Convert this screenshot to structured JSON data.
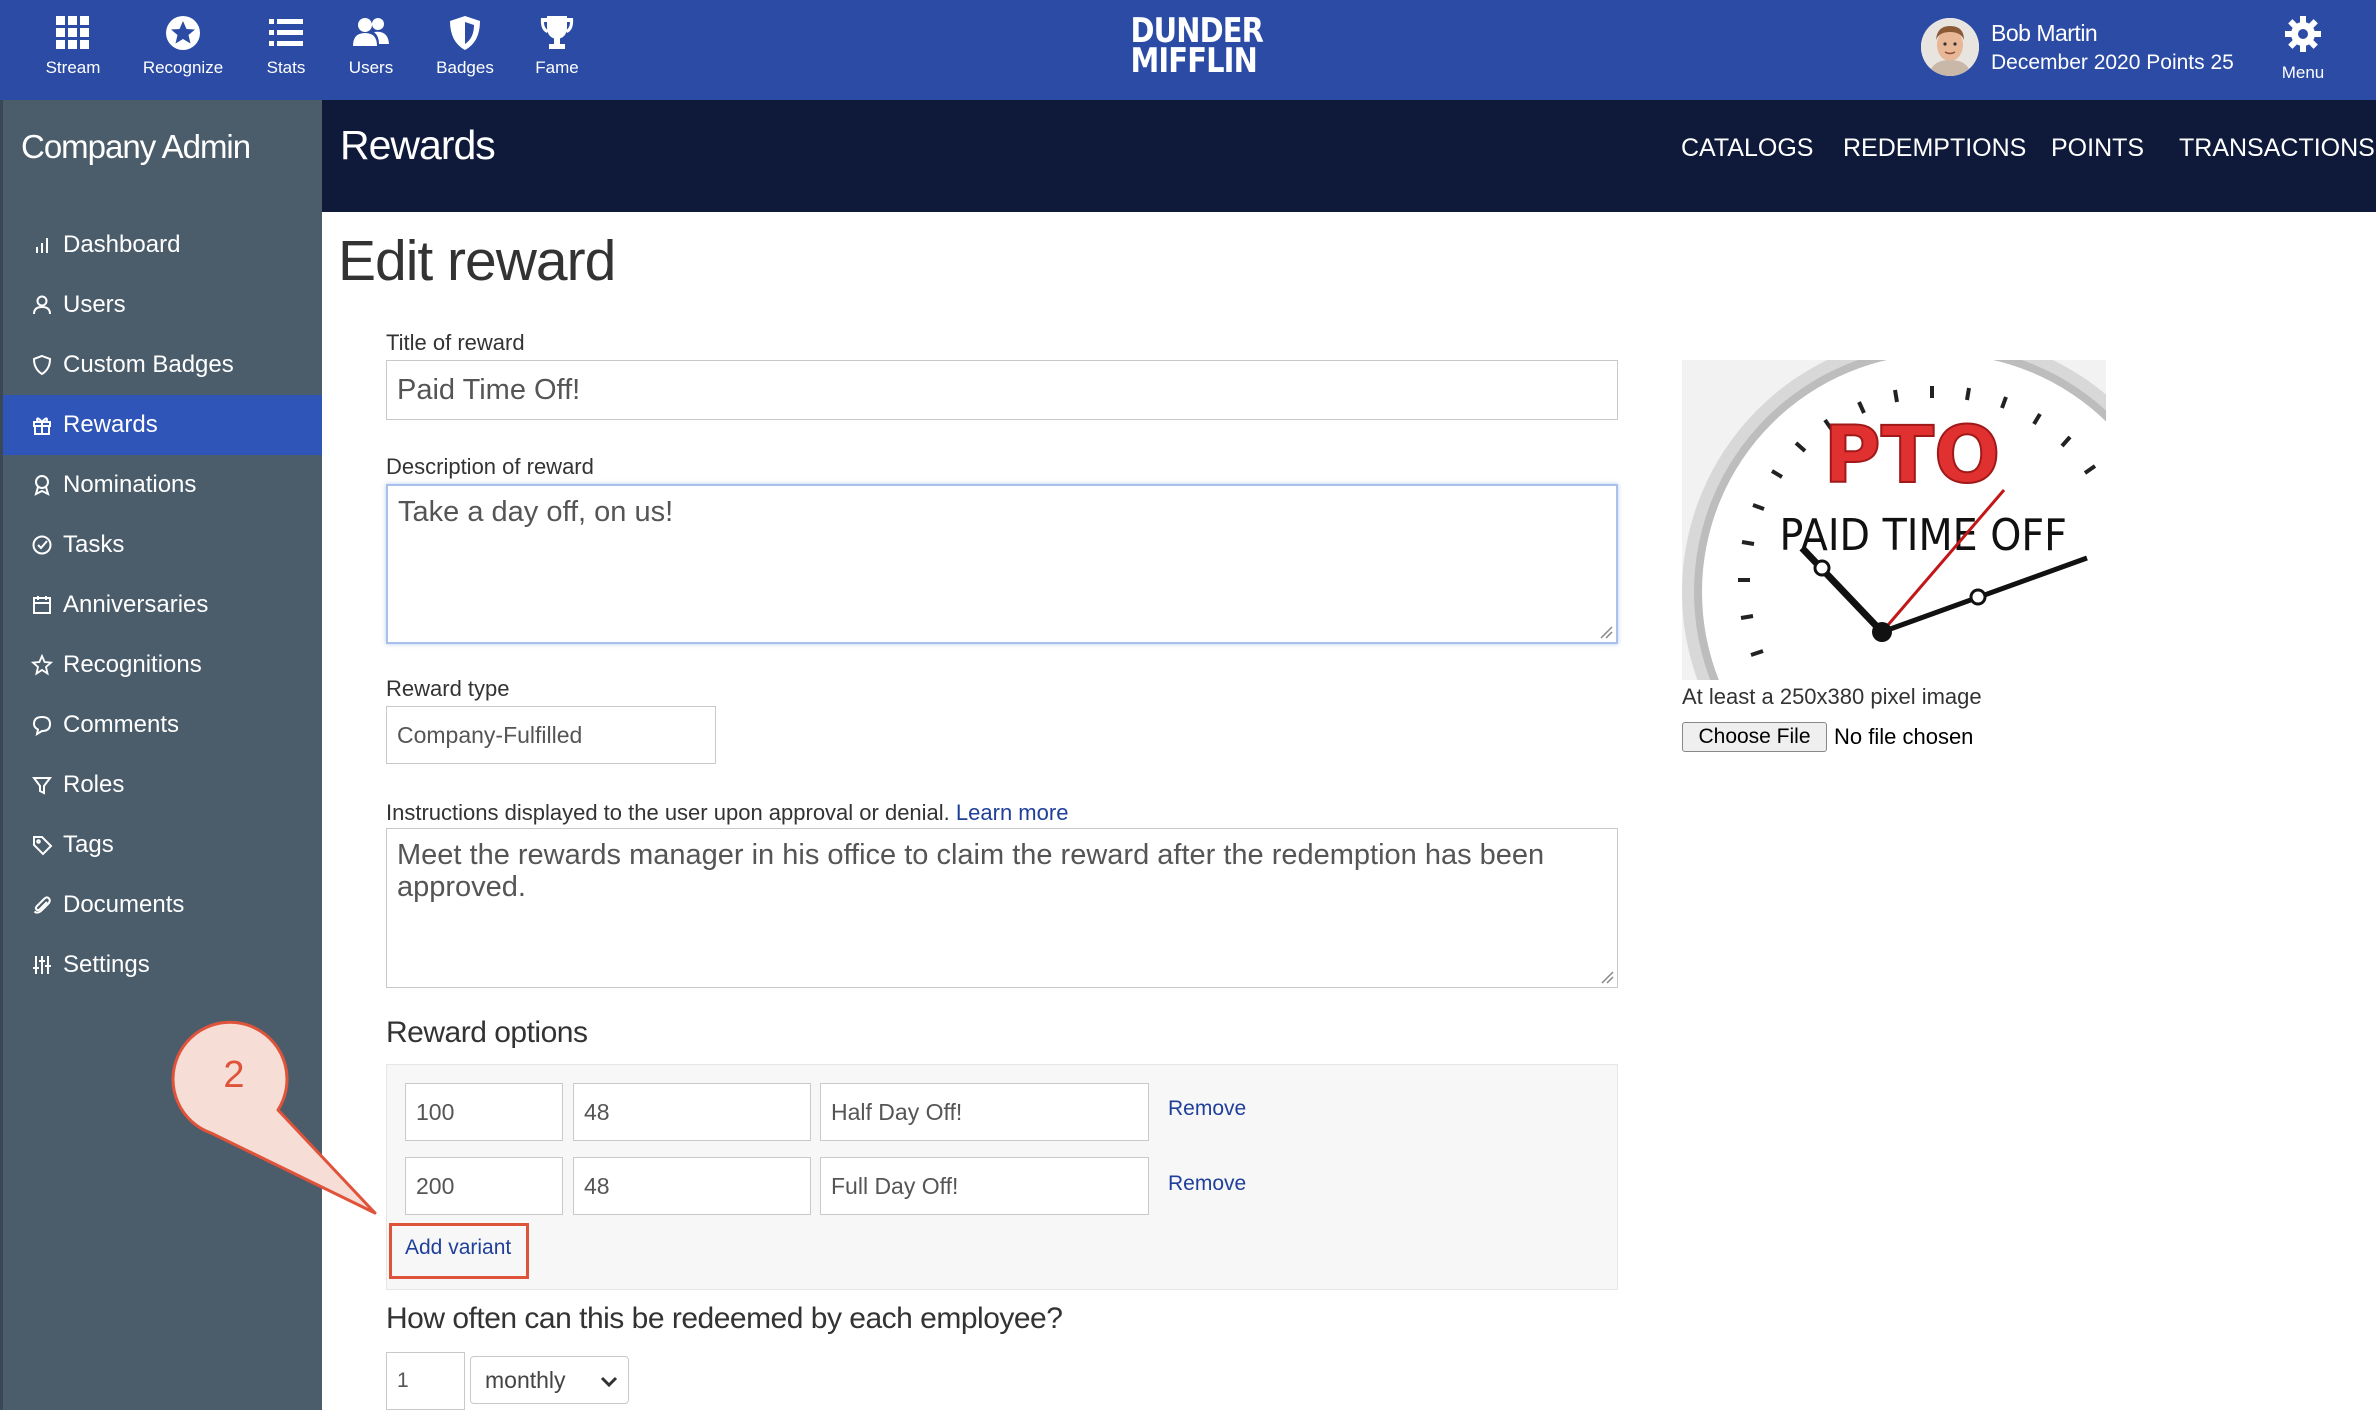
{
  "topnav": {
    "items": [
      {
        "label": "Stream",
        "icon": "grid-icon"
      },
      {
        "label": "Recognize",
        "icon": "star-badge-icon"
      },
      {
        "label": "Stats",
        "icon": "list-icon"
      },
      {
        "label": "Users",
        "icon": "users-icon"
      },
      {
        "label": "Badges",
        "icon": "shield-icon"
      },
      {
        "label": "Fame",
        "icon": "trophy-icon"
      }
    ],
    "logo_line1": "DUNDER",
    "logo_line2": "MIFFLIN",
    "user_name": "Bob Martin",
    "user_points": "December 2020 Points 25",
    "menu_label": "Menu"
  },
  "sidebar": {
    "title": "Company Admin",
    "items": [
      {
        "label": "Dashboard",
        "icon": "bar-chart-icon"
      },
      {
        "label": "Users",
        "icon": "user-icon"
      },
      {
        "label": "Custom Badges",
        "icon": "shield-icon"
      },
      {
        "label": "Rewards",
        "icon": "gift-icon",
        "active": true
      },
      {
        "label": "Nominations",
        "icon": "ribbon-icon"
      },
      {
        "label": "Tasks",
        "icon": "check-circle-icon"
      },
      {
        "label": "Anniversaries",
        "icon": "calendar-icon"
      },
      {
        "label": "Recognitions",
        "icon": "star-icon"
      },
      {
        "label": "Comments",
        "icon": "comment-icon"
      },
      {
        "label": "Roles",
        "icon": "filter-icon"
      },
      {
        "label": "Tags",
        "icon": "tag-icon"
      },
      {
        "label": "Documents",
        "icon": "paperclip-icon"
      },
      {
        "label": "Settings",
        "icon": "sliders-icon"
      }
    ]
  },
  "subheader": {
    "title": "Rewards",
    "links": [
      "CATALOGS",
      "REDEMPTIONS",
      "POINTS",
      "TRANSACTIONS"
    ]
  },
  "form": {
    "page_title": "Edit reward",
    "title_label": "Title of reward",
    "title_value": "Paid Time Off!",
    "description_label": "Description of reward",
    "description_value": "Take a day off, on us!",
    "type_label": "Reward type",
    "type_value": "Company-Fulfilled",
    "instructions_label": "Instructions displayed to the user upon approval or denial.",
    "learn_more": "Learn more",
    "instructions_value": "Meet the rewards manager in his office to claim the reward after the redemption has been approved.",
    "options_title": "Reward options",
    "options": [
      {
        "points": "100",
        "qty": "48",
        "name": "Half Day Off!",
        "remove": "Remove"
      },
      {
        "points": "200",
        "qty": "48",
        "name": "Full Day Off!",
        "remove": "Remove"
      }
    ],
    "add_variant": "Add variant",
    "frequency_title": "How often can this be redeemed by each employee?",
    "frequency_count": "1",
    "frequency_period": "monthly"
  },
  "image": {
    "text_big": "PTO",
    "text_small": "PAID TIME OFF",
    "note": "At least a 250x380 pixel image",
    "choose_file": "Choose File",
    "no_file": "No file chosen"
  },
  "callout": {
    "number": "2"
  },
  "colors": {
    "topbar": "#2b4ba5",
    "sidebar": "#4b5c6b",
    "active": "#2f55b8",
    "subheader": "#0f1a3a",
    "accent": "#e0533b",
    "link": "#1f3f9a"
  }
}
